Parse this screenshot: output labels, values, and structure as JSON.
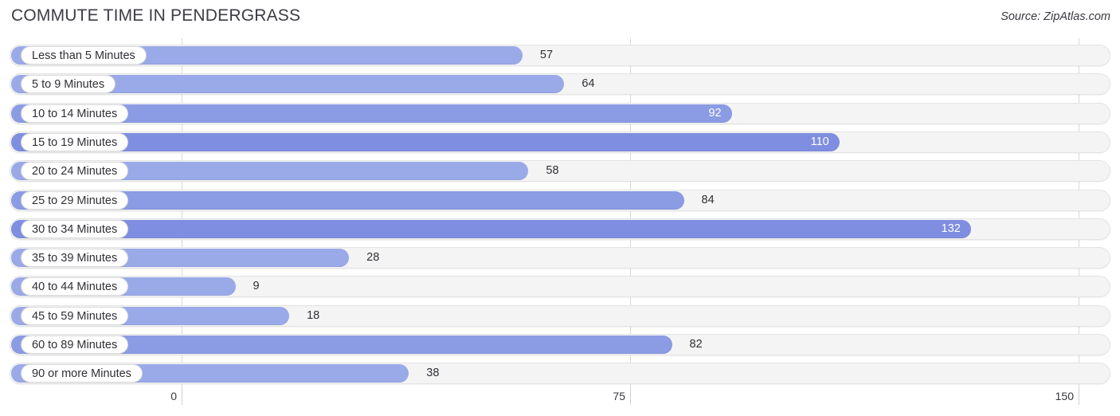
{
  "header": {
    "title": "COMMUTE TIME IN PENDERGRASS",
    "source": "Source: ZipAtlas.com"
  },
  "colors": {
    "bar_light": "#9aaae8",
    "bar_mid": "#8b9be4",
    "bar_dark": "#7f8ee0",
    "track": "#f4f4f4",
    "track_border": "#e3e3e3",
    "grid": "#d8d8d8",
    "text": "#2f2f35",
    "value_inside": "#ffffff"
  },
  "chart_data": {
    "type": "bar",
    "orientation": "horizontal",
    "title": "COMMUTE TIME IN PENDERGRASS",
    "xlabel": "",
    "ylabel": "",
    "xlim": [
      0,
      150
    ],
    "xticks": [
      0,
      75,
      150
    ],
    "xtick_labels": [
      "0",
      "75",
      "150"
    ],
    "grid": true,
    "legend": false,
    "categories": [
      "Less than 5 Minutes",
      "5 to 9 Minutes",
      "10 to 14 Minutes",
      "15 to 19 Minutes",
      "20 to 24 Minutes",
      "25 to 29 Minutes",
      "30 to 34 Minutes",
      "35 to 39 Minutes",
      "40 to 44 Minutes",
      "45 to 59 Minutes",
      "60 to 89 Minutes",
      "90 or more Minutes"
    ],
    "values": [
      57,
      64,
      92,
      110,
      58,
      84,
      132,
      28,
      9,
      18,
      82,
      38
    ],
    "value_labels": [
      "57",
      "64",
      "92",
      "110",
      "58",
      "84",
      "132",
      "28",
      "9",
      "18",
      "82",
      "38"
    ],
    "label_placement": [
      "outside",
      "outside",
      "inside",
      "inside",
      "outside",
      "outside",
      "inside",
      "outside",
      "outside",
      "outside",
      "outside",
      "outside"
    ]
  }
}
